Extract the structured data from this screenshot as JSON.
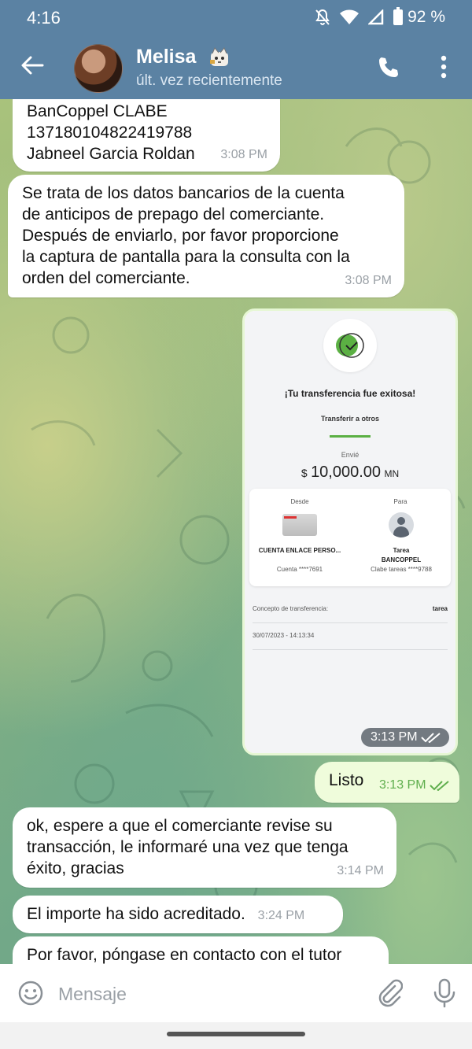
{
  "status_bar": {
    "time": "4:16",
    "battery": "92 %"
  },
  "header": {
    "contact_name": "Melisa",
    "status": "últ. vez recientemente"
  },
  "messages": [
    {
      "type": "in",
      "lines": [
        "BanCoppel   CLABE",
        "137180104822419788",
        "Jabneel Garcia Roldan"
      ],
      "time": "3:08 PM"
    },
    {
      "type": "in",
      "lines": [
        "Se trata de los datos bancarios de la cuenta",
        "de anticipos de prepago del comerciante.",
        "Después de enviarlo, por favor proporcione",
        "la captura de pantalla para la consulta con la",
        "orden del comerciante."
      ],
      "time": "3:08 PM"
    },
    {
      "type": "out-image",
      "time": "3:13 PM"
    },
    {
      "type": "out",
      "lines": [
        "Listo"
      ],
      "time": "3:13 PM"
    },
    {
      "type": "in",
      "lines": [
        "ok, espere a que el comerciante revise su",
        "transacción, le informaré una vez que tenga",
        "éxito, gracias"
      ],
      "time": "3:14 PM"
    },
    {
      "type": "in",
      "lines": [
        "El importe ha sido acreditado."
      ],
      "time": "3:24 PM"
    },
    {
      "type": "in",
      "lines": [
        "Por favor, póngase en contacto con el tutor"
      ],
      "time": ""
    }
  ],
  "receipt": {
    "title": "¡Tu transferencia fue exitosa!",
    "subtitle": "Transferir a otros",
    "sent_label": "Envié",
    "currency_symbol": "$",
    "amount": "10,000.00",
    "currency": "MN",
    "from_label": "Desde",
    "to_label": "Para",
    "from_account": "CUENTA ENLACE PERSO...",
    "from_number": "Cuenta ****7691",
    "to_name": "Tarea",
    "to_bank": "BANCOPPEL",
    "to_clabe": "Clabe tareas ****9788",
    "concept_label": "Concepto de transferencia:",
    "concept_value": "tarea",
    "datetime": "30/07/2023 - 14:13:34"
  },
  "input": {
    "placeholder": "Mensaje"
  },
  "colors": {
    "header": "#5b82a3",
    "bubble_in": "#ffffff",
    "bubble_out": "#effcdb",
    "accent_green": "#5bb043"
  }
}
